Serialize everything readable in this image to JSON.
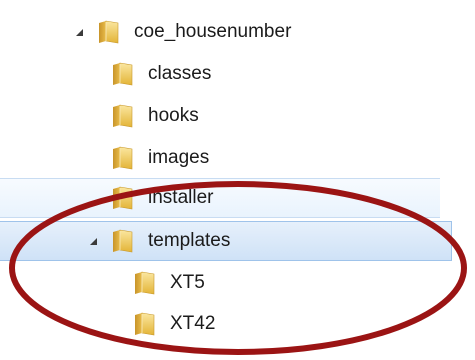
{
  "tree": {
    "items": [
      {
        "label": "coe_housenumber",
        "expanded": true,
        "level": 0
      },
      {
        "label": "classes",
        "level": 1
      },
      {
        "label": "hooks",
        "level": 1
      },
      {
        "label": "images",
        "level": 1
      },
      {
        "label": "installer",
        "level": 1
      },
      {
        "label": "templates",
        "expanded": true,
        "level": 1
      },
      {
        "label": "XT5",
        "level": 2
      },
      {
        "label": "XT42",
        "level": 2
      }
    ]
  },
  "colors": {
    "highlight_circle": "#9b1414",
    "folder_yellow": "#f2c94c",
    "selection_fill": "#d6e6f8",
    "selection_border": "#9fc3ea"
  },
  "icons": {
    "expand_arrow": "expanded-triangle-icon",
    "folder": "folder-icon"
  }
}
